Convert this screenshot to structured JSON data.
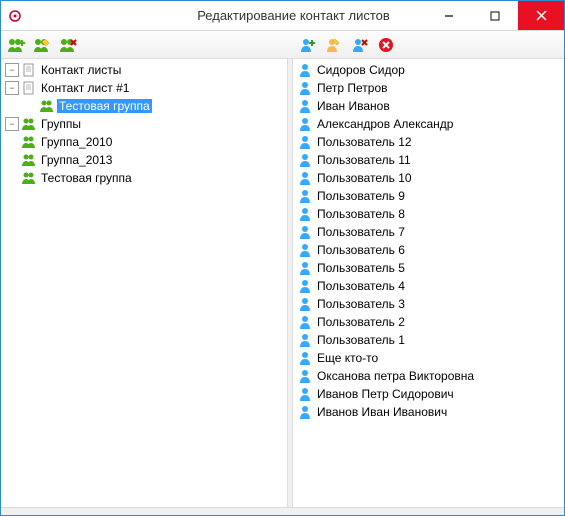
{
  "window": {
    "title": "Редактирование контакт листов"
  },
  "tree": {
    "root_contact_lists": "Контакт листы",
    "contact_list_1": "Контакт лист #1",
    "test_group_under_list": "Тестовая группа",
    "root_groups": "Группы",
    "group_2010": "Группа_2010",
    "group_2013": "Группа_2013",
    "group_test": "Тестовая группа"
  },
  "contacts": [
    "Сидоров Сидор",
    "Петр Петров",
    "Иван Иванов",
    "Александров Александр",
    "Пользователь 12",
    "Пользователь 11",
    "Пользователь 10",
    "Пользователь 9",
    "Пользователь 8",
    "Пользователь 7",
    "Пользователь 6",
    "Пользователь 5",
    "Пользователь 4",
    "Пользователь 3",
    "Пользователь 2",
    "Пользователь 1",
    "Еще кто-то",
    "Оксанова петра Викторовна",
    "Иванов Петр Сидорович",
    "Иванов Иван Иванович"
  ]
}
